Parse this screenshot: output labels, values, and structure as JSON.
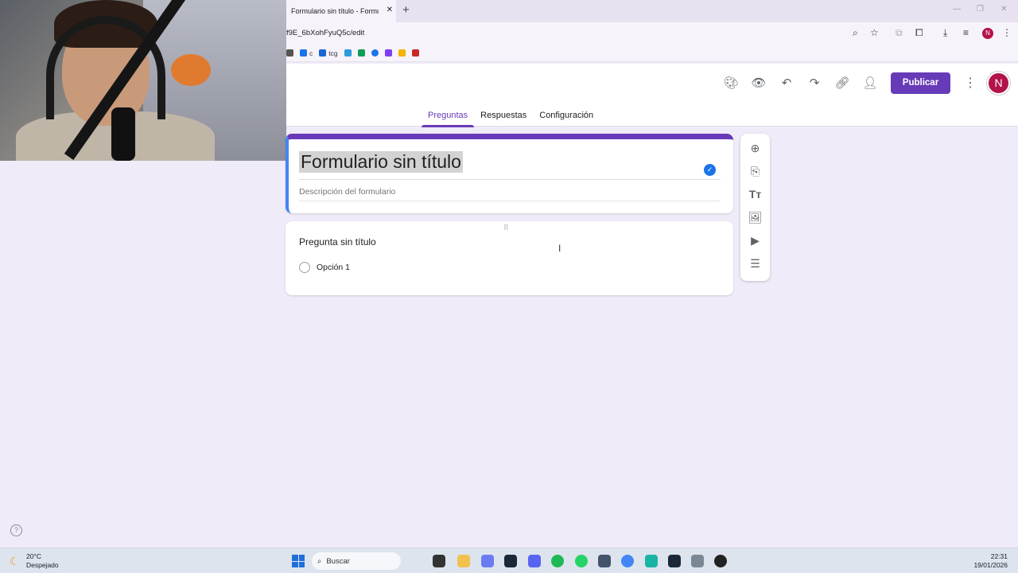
{
  "browser": {
    "tab_title": "Formulario sin título - Formulario",
    "tab_close": "✕",
    "new_tab": "+",
    "url": "f9E_6bXohFyuQ5c/edit",
    "profile_initial": "N",
    "bookmarks": [
      {
        "label": "c",
        "color": "#1a73e8"
      },
      {
        "label": "tcg",
        "color": "#1967d2"
      },
      {
        "label": "",
        "color": "#2d9cdb"
      },
      {
        "label": "",
        "color": "#0f9d58"
      },
      {
        "label": "",
        "color": "#1a73e8"
      },
      {
        "label": "",
        "color": "#7e3ff2"
      },
      {
        "label": "",
        "color": "#f4b400"
      },
      {
        "label": "",
        "color": "#c62828"
      }
    ]
  },
  "forms": {
    "publish_label": "Publicar",
    "profile_initial": "N",
    "tabs": [
      {
        "label": "Preguntas",
        "active": true
      },
      {
        "label": "Respuestas",
        "active": false
      },
      {
        "label": "Configuración",
        "active": false
      }
    ],
    "title": "Formulario sin título",
    "description_placeholder": "Descripción del formulario",
    "question": {
      "title": "Pregunta sin título",
      "option_1": "Opción 1"
    },
    "colors": {
      "accent": "#673ab7",
      "background": "#f0ebf8",
      "focus": "#4285f4"
    }
  },
  "taskbar": {
    "weather_temp": "20°C",
    "weather_desc": "Despejado",
    "search_placeholder": "Buscar",
    "time": "22:31",
    "date": "19/01/2026"
  }
}
